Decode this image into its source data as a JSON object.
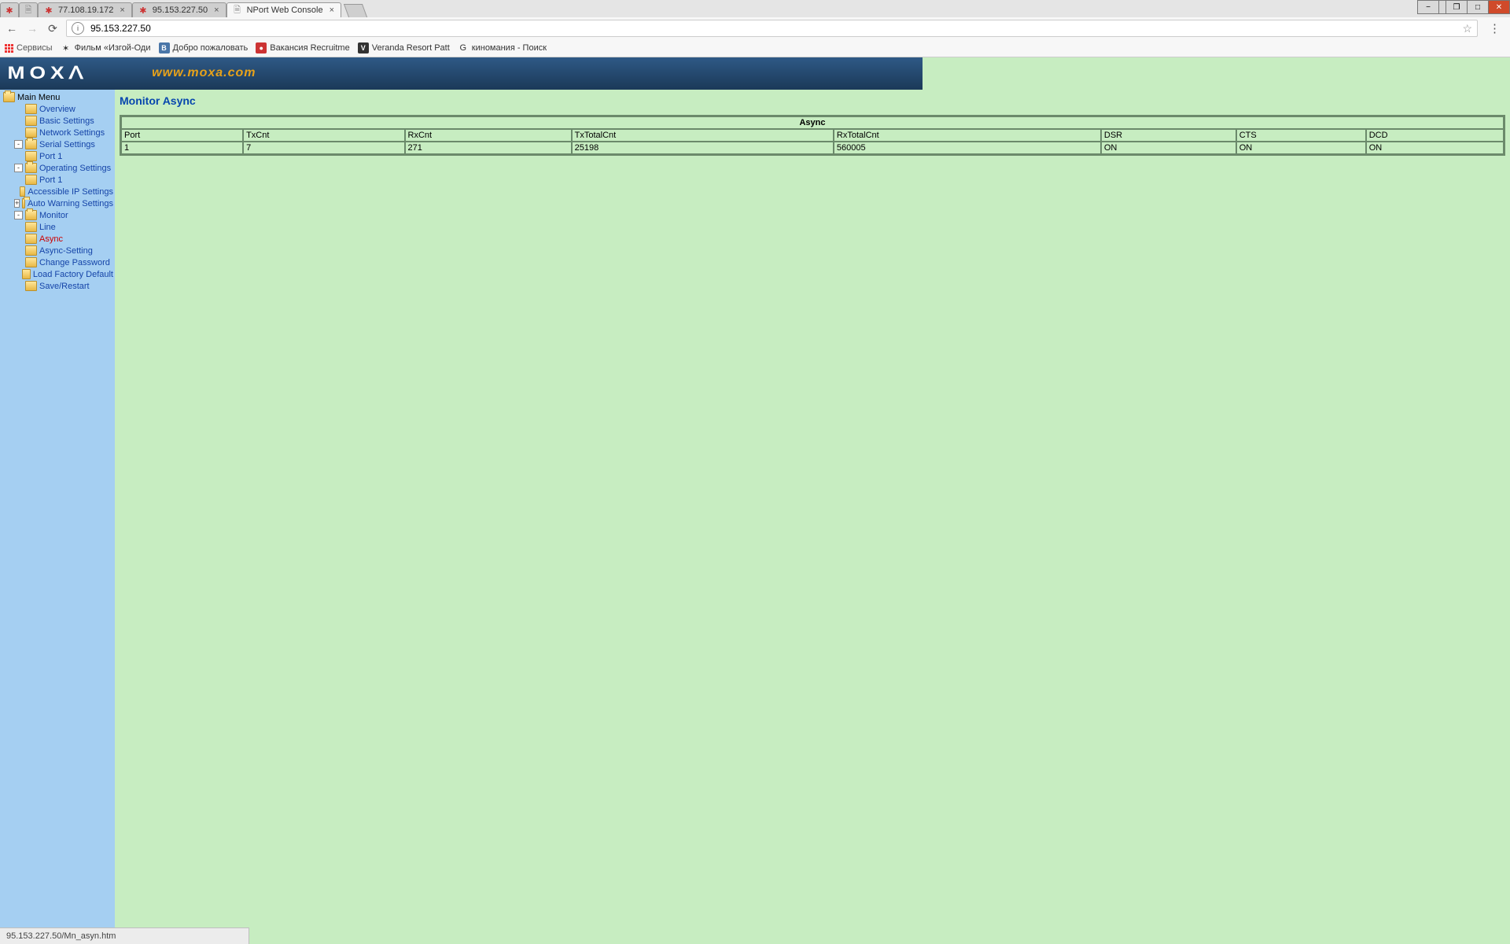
{
  "window": {
    "min": "−",
    "sep": "",
    "restore": "❐",
    "max": "□",
    "close": "✕"
  },
  "tabs": [
    {
      "label": "",
      "fav": "red",
      "closable": false
    },
    {
      "label": "",
      "fav": "doc",
      "closable": false
    },
    {
      "label": "77.108.19.172",
      "fav": "red",
      "closable": true
    },
    {
      "label": "95.153.227.50",
      "fav": "red",
      "closable": true
    },
    {
      "label": "NPort Web Console",
      "fav": "doc",
      "closable": true,
      "active": true
    }
  ],
  "addr": {
    "url": "95.153.227.50"
  },
  "bookmarks": {
    "apps": "Сервисы",
    "items": [
      {
        "icon": "✶",
        "label": "Фильм «Изгой-Оди"
      },
      {
        "icon": "B",
        "label": "Добро пожаловать",
        "boxcolor": "#4a76a8"
      },
      {
        "icon": "●",
        "label": "Вакансия Recruitme",
        "boxcolor": "#c33"
      },
      {
        "icon": "V",
        "label": "Veranda Resort Patt",
        "boxcolor": "#333"
      },
      {
        "icon": "G",
        "label": "киномания - Поиск",
        "boxcolor": ""
      }
    ]
  },
  "banner": {
    "logo": "MOXᐱ",
    "url": "www.moxa.com"
  },
  "menu": {
    "root": "Main Menu",
    "items": [
      {
        "label": "Overview",
        "lvl": 1
      },
      {
        "label": "Basic Settings",
        "lvl": 1
      },
      {
        "label": "Network Settings",
        "lvl": 1
      },
      {
        "label": "Serial Settings",
        "lvl": 1,
        "exp": "-"
      },
      {
        "label": "Port 1",
        "lvl": 2
      },
      {
        "label": "Operating Settings",
        "lvl": 1,
        "exp": "-"
      },
      {
        "label": "Port 1",
        "lvl": 2
      },
      {
        "label": "Accessible IP Settings",
        "lvl": 1
      },
      {
        "label": "Auto Warning Settings",
        "lvl": 1,
        "exp": "+"
      },
      {
        "label": "Monitor",
        "lvl": 1,
        "exp": "-"
      },
      {
        "label": "Line",
        "lvl": 2
      },
      {
        "label": "Async",
        "lvl": 2,
        "active": true
      },
      {
        "label": "Async-Setting",
        "lvl": 2
      },
      {
        "label": "Change Password",
        "lvl": 1
      },
      {
        "label": "Load Factory Default",
        "lvl": 1
      },
      {
        "label": "Save/Restart",
        "lvl": 1
      }
    ]
  },
  "content": {
    "title": "Monitor Async",
    "table": {
      "caption": "Async",
      "headers": [
        "Port",
        "TxCnt",
        "RxCnt",
        "TxTotalCnt",
        "RxTotalCnt",
        "DSR",
        "CTS",
        "DCD"
      ],
      "rows": [
        [
          "1",
          "7",
          "271",
          "25198",
          "560005",
          "ON",
          "ON",
          "ON"
        ]
      ]
    }
  },
  "status": "95.153.227.50/Mn_asyn.htm"
}
